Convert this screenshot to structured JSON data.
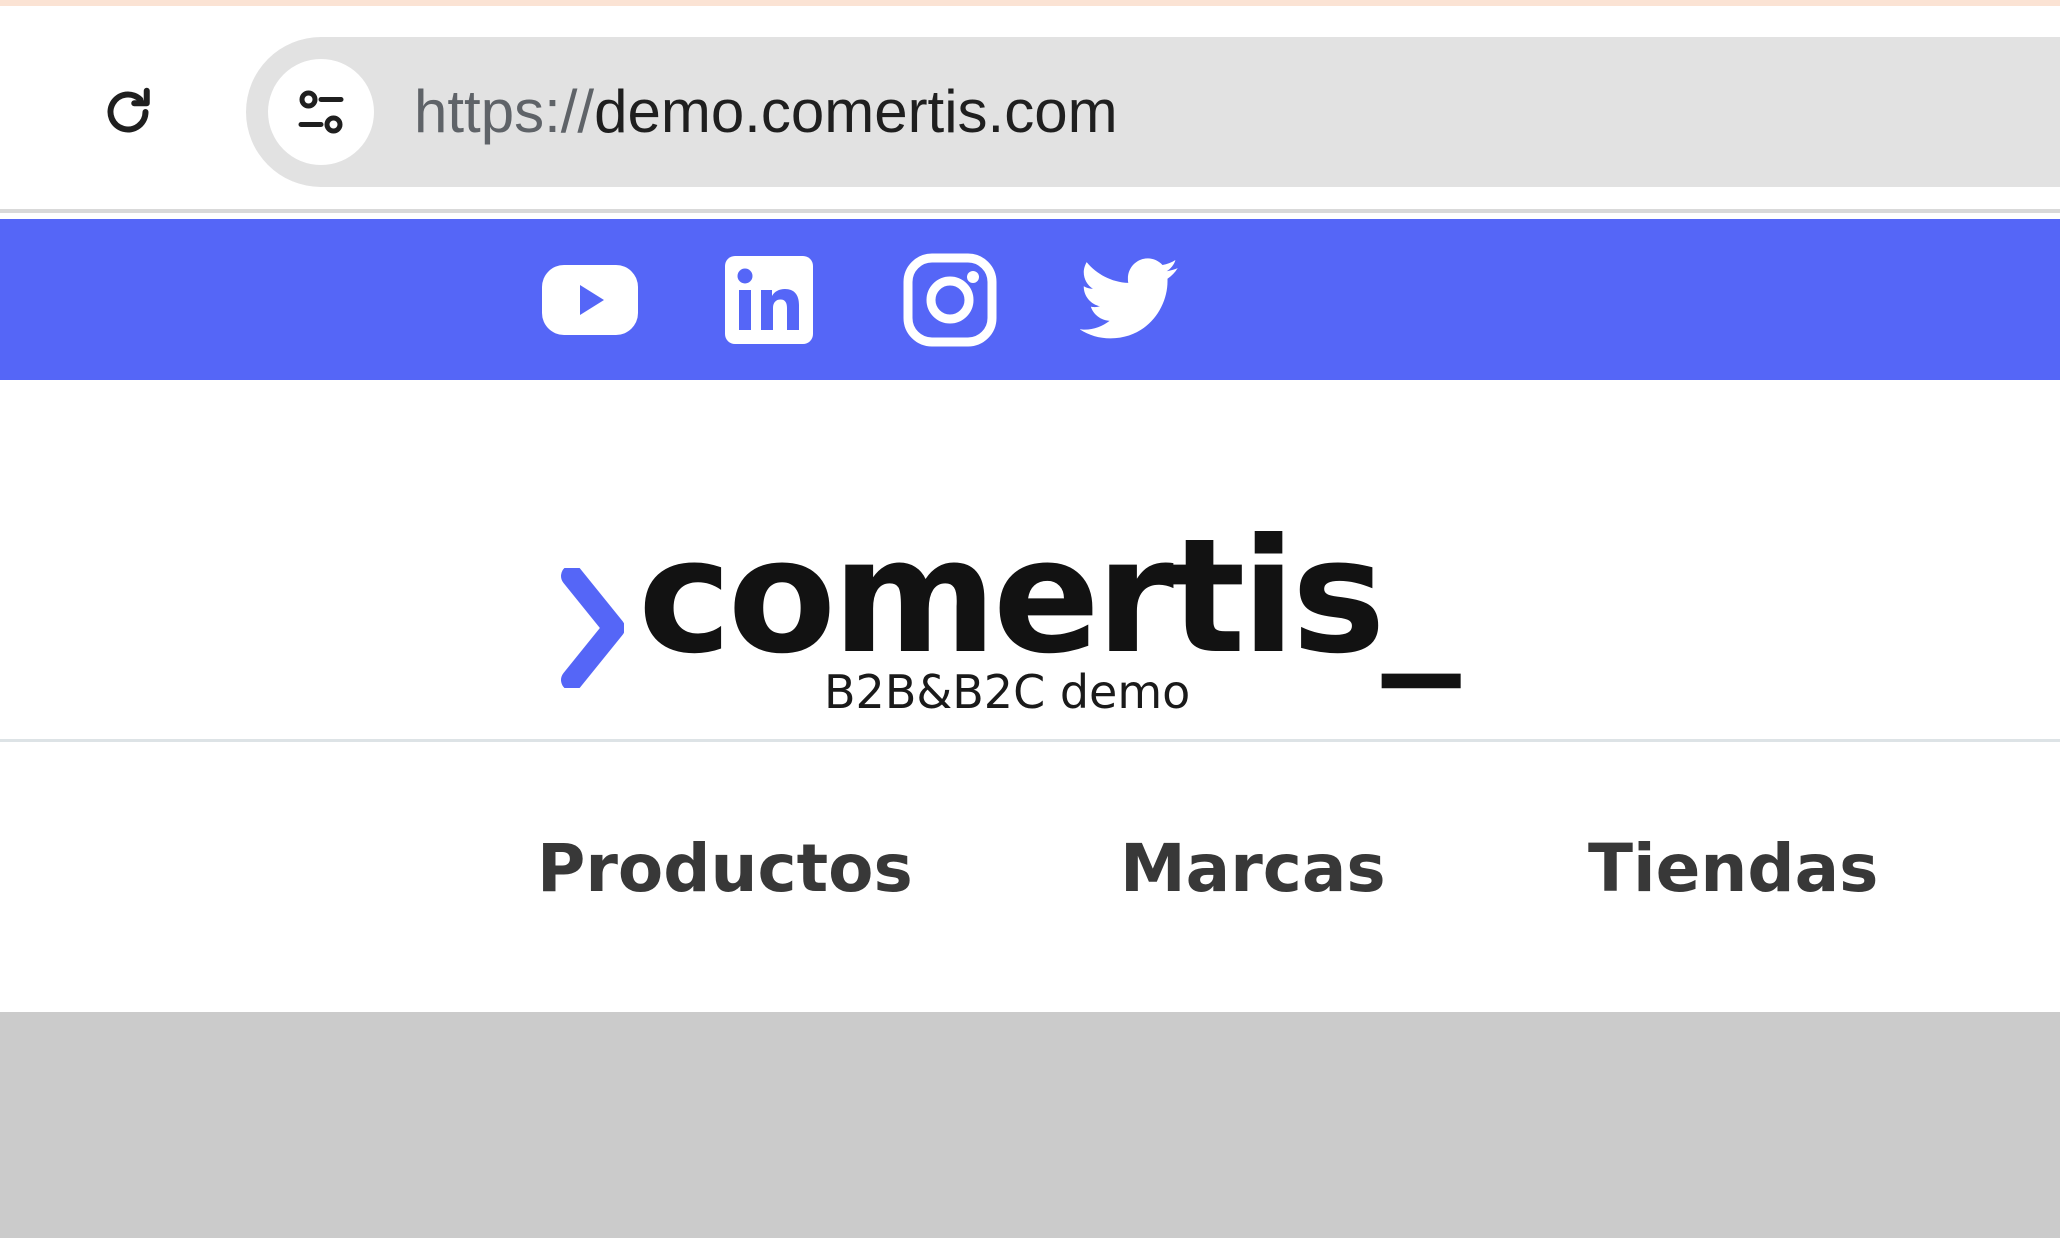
{
  "browser": {
    "url_scheme": "https://",
    "url_host": "demo.comertis.com"
  },
  "social": [
    {
      "name": "youtube-icon",
      "color": "#ffffff"
    },
    {
      "name": "linkedin-icon",
      "color": "#ffffff"
    },
    {
      "name": "instagram-icon",
      "color": "#ffffff"
    },
    {
      "name": "twitter-icon",
      "color": "#ffffff"
    }
  ],
  "logo": {
    "wordmark": "comertis_",
    "tagline": "B2B&B2C demo"
  },
  "nav": {
    "items": [
      {
        "label": "Productos"
      },
      {
        "label": "Marcas"
      },
      {
        "label": "Tiendas"
      }
    ]
  },
  "colors": {
    "accent": "#5566f7",
    "text_dark": "#121212",
    "nav_text": "#383838",
    "content_gray": "#cbcbcb"
  }
}
